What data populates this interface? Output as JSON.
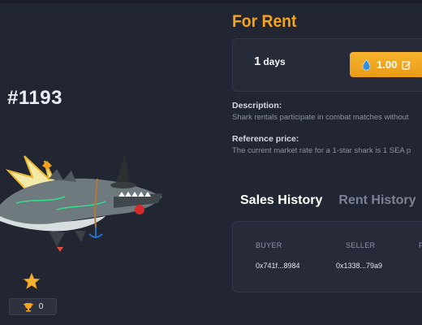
{
  "nft": {
    "id_title": "#1193"
  },
  "stats": {
    "trophy_count": "0"
  },
  "rent": {
    "heading": "For Rent",
    "duration_value": "1",
    "duration_unit": "days",
    "price": "1.00"
  },
  "description": {
    "label": "Description:",
    "text": "Shark rentals participate in combat matches without"
  },
  "reference": {
    "label": "Reference price:",
    "text": "The current market rate for a 1-star shark is 1 SEA p"
  },
  "tabs": [
    {
      "label": "Sales History",
      "active": true
    },
    {
      "label": "Rent History",
      "active": false
    }
  ],
  "history": {
    "columns": [
      "BUYER",
      "SELLER",
      "P"
    ],
    "rows": [
      [
        "0x741f...8984",
        "0x1338...79a9"
      ]
    ]
  },
  "colors": {
    "accent": "#f5a319",
    "background": "#222633",
    "card": "#272b39"
  }
}
